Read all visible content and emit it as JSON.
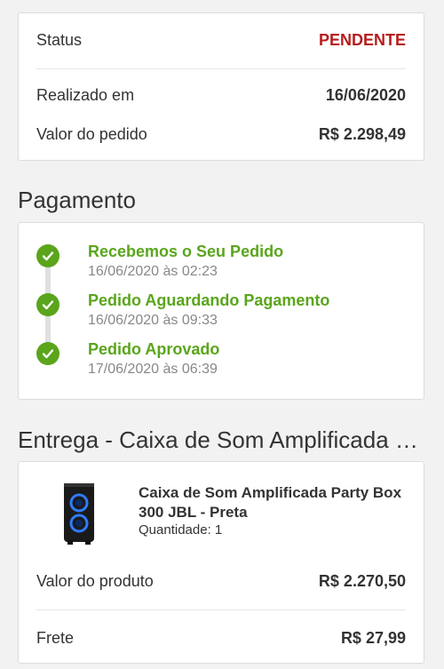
{
  "summary": {
    "status_label": "Status",
    "status_value": "PENDENTE",
    "placed_label": "Realizado em",
    "placed_value": "16/06/2020",
    "total_label": "Valor do pedido",
    "total_value": "R$ 2.298,49"
  },
  "payment": {
    "title": "Pagamento",
    "steps": [
      {
        "title": "Recebemos o Seu Pedido",
        "date": "16/06/2020 às 02:23"
      },
      {
        "title": "Pedido Aguardando Pagamento",
        "date": "16/06/2020 às 09:33"
      },
      {
        "title": "Pedido Aprovado",
        "date": "17/06/2020 às 06:39"
      }
    ]
  },
  "delivery": {
    "title": "Entrega - Caixa de Som Amplificada P...",
    "product_name": "Caixa de Som Amplificada Party Box 300 JBL - Preta",
    "quantity": "Quantidade: 1",
    "product_value_label": "Valor do produto",
    "product_value": "R$ 2.270,50",
    "shipping_label": "Frete",
    "shipping_value": "R$ 27,99"
  },
  "colors": {
    "pending": "#b71c1c",
    "success": "#5aa51c"
  },
  "icons": {
    "step_check": "check-circle-icon"
  }
}
